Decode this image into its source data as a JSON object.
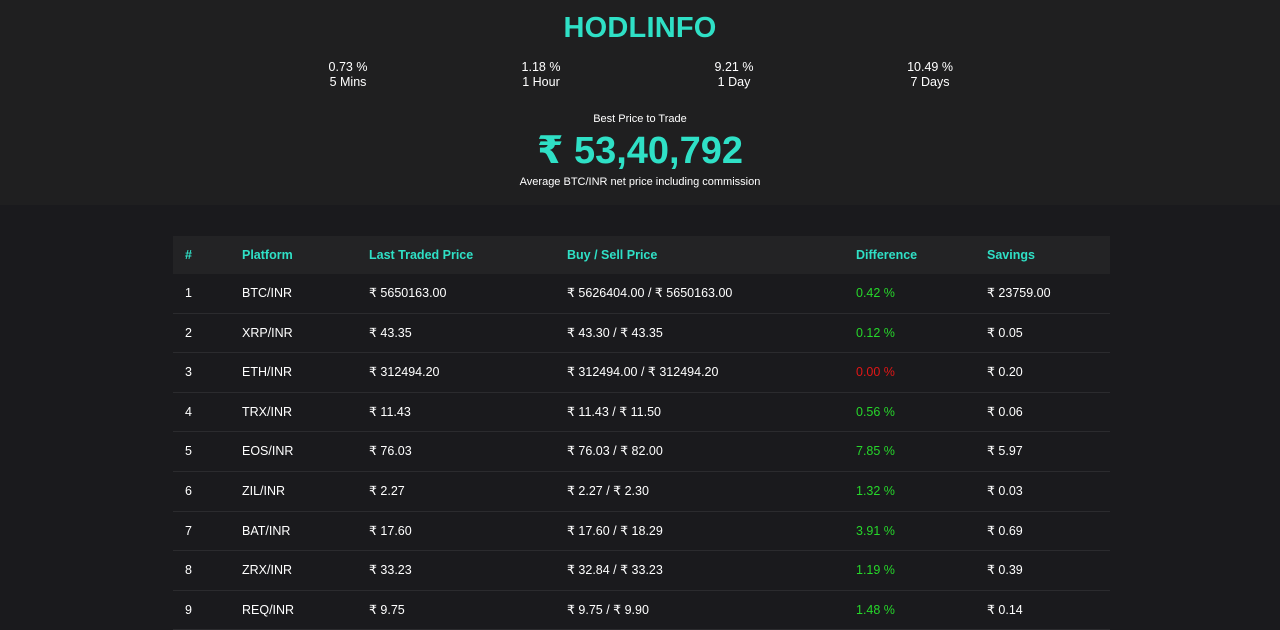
{
  "brand": {
    "logo_text": "HODLINFO"
  },
  "stats": [
    {
      "value": "0.73 %",
      "period": "5 Mins"
    },
    {
      "value": "1.18 %",
      "period": "1 Hour"
    },
    {
      "value": "9.21 %",
      "period": "1 Day"
    },
    {
      "value": "10.49 %",
      "period": "7 Days"
    }
  ],
  "best_price": {
    "label": "Best Price to Trade",
    "value": "₹ 53,40,792",
    "note": "Average BTC/INR net price including commission"
  },
  "colors": {
    "accent": "#2fe0c6",
    "positive": "#26d62a",
    "negative": "#e01616"
  },
  "table": {
    "headers": [
      "#",
      "Platform",
      "Last Traded Price",
      "Buy / Sell Price",
      "Difference",
      "Savings"
    ],
    "rows": [
      {
        "num": "1",
        "platform": "BTC/INR",
        "last": "₹ 5650163.00",
        "buy_sell": "₹ 5626404.00 / ₹ 5650163.00",
        "diff": "0.42 %",
        "diff_state": "positive",
        "savings": "₹ 23759.00"
      },
      {
        "num": "2",
        "platform": "XRP/INR",
        "last": "₹ 43.35",
        "buy_sell": "₹ 43.30 / ₹ 43.35",
        "diff": "0.12 %",
        "diff_state": "positive",
        "savings": "₹ 0.05"
      },
      {
        "num": "3",
        "platform": "ETH/INR",
        "last": "₹ 312494.20",
        "buy_sell": "₹ 312494.00 / ₹ 312494.20",
        "diff": "0.00 %",
        "diff_state": "negative",
        "savings": "₹ 0.20"
      },
      {
        "num": "4",
        "platform": "TRX/INR",
        "last": "₹ 11.43",
        "buy_sell": "₹ 11.43 / ₹ 11.50",
        "diff": "0.56 %",
        "diff_state": "positive",
        "savings": "₹ 0.06"
      },
      {
        "num": "5",
        "platform": "EOS/INR",
        "last": "₹ 76.03",
        "buy_sell": "₹ 76.03 / ₹ 82.00",
        "diff": "7.85 %",
        "diff_state": "positive",
        "savings": "₹ 5.97"
      },
      {
        "num": "6",
        "platform": "ZIL/INR",
        "last": "₹ 2.27",
        "buy_sell": "₹ 2.27 / ₹ 2.30",
        "diff": "1.32 %",
        "diff_state": "positive",
        "savings": "₹ 0.03"
      },
      {
        "num": "7",
        "platform": "BAT/INR",
        "last": "₹ 17.60",
        "buy_sell": "₹ 17.60 / ₹ 18.29",
        "diff": "3.91 %",
        "diff_state": "positive",
        "savings": "₹ 0.69"
      },
      {
        "num": "8",
        "platform": "ZRX/INR",
        "last": "₹ 33.23",
        "buy_sell": "₹ 32.84 / ₹ 33.23",
        "diff": "1.19 %",
        "diff_state": "positive",
        "savings": "₹ 0.39"
      },
      {
        "num": "9",
        "platform": "REQ/INR",
        "last": "₹ 9.75",
        "buy_sell": "₹ 9.75 / ₹ 9.90",
        "diff": "1.48 %",
        "diff_state": "positive",
        "savings": "₹ 0.14"
      }
    ]
  }
}
